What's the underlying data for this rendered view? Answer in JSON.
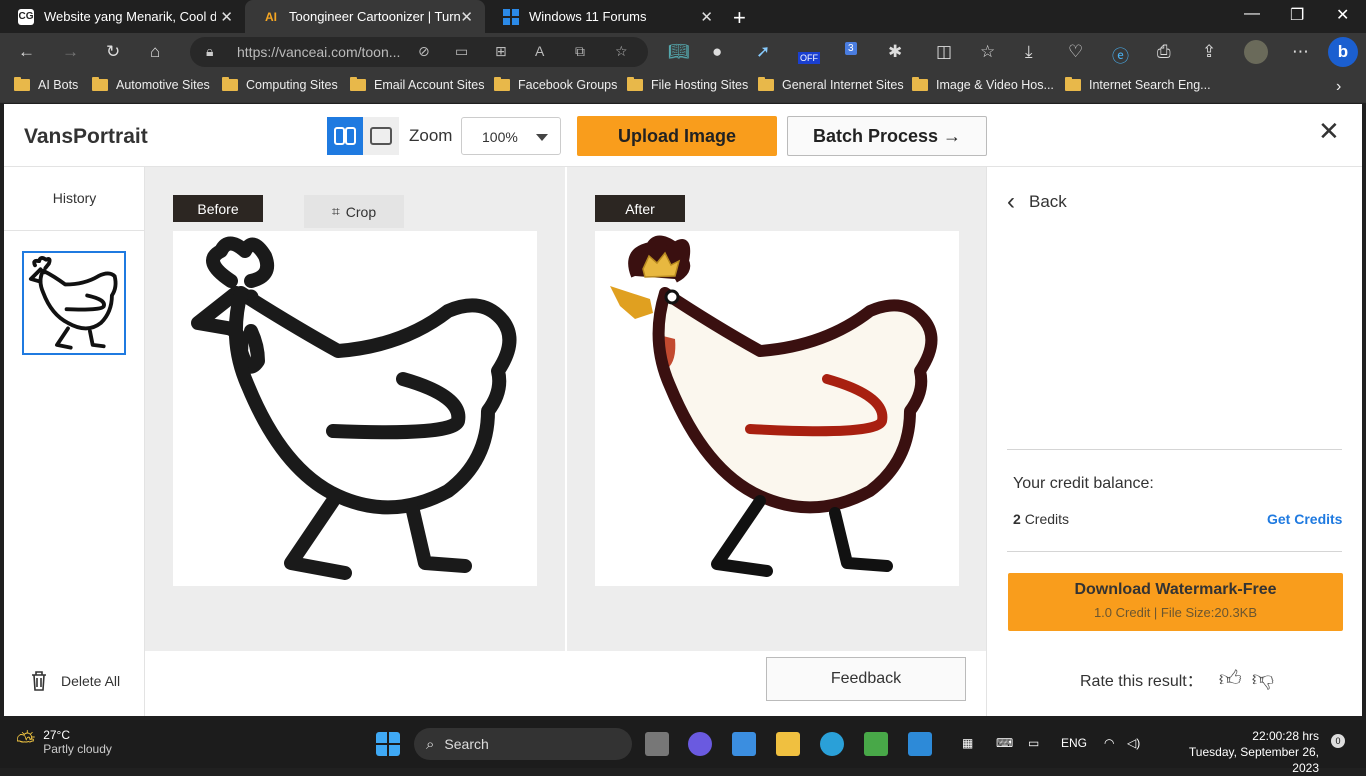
{
  "browser": {
    "tabs": [
      {
        "title": "Website yang Menarik, Cool dan",
        "favicon": "CG"
      },
      {
        "title": "Toongineer Cartoonizer | Turn Ph",
        "favicon": "AI"
      },
      {
        "title": "Windows 11 Forums",
        "favicon": "win"
      }
    ],
    "address": "https://vanceai.com/toon...",
    "bookmarks": [
      "AI Bots",
      "Automotive Sites",
      "Computing Sites",
      "Email Account Sites",
      "Facebook Groups",
      "File Hosting Sites",
      "General Internet Sites",
      "Image & Video Hos...",
      "Internet Search Eng..."
    ],
    "ext_badge_off": "OFF",
    "ext_badge_count": "3"
  },
  "app": {
    "brand": "VansPortrait",
    "zoom_label": "Zoom",
    "zoom_value": "100%",
    "upload_label": "Upload Image",
    "batch_label": "Batch Process →",
    "history_title": "History",
    "delete_all": "Delete All",
    "before_label": "Before",
    "crop_label": "Crop",
    "after_label": "After",
    "feedback_label": "Feedback",
    "back_label": "Back",
    "credit_balance_label": "Your credit balance:",
    "credits_count": "2",
    "credits_unit": "Credits",
    "get_credits": "Get Credits",
    "download_title": "Download Watermark-Free",
    "download_sub": "1.0 Credit | File Size:20.3KB",
    "rate_label": "Rate this result："
  },
  "taskbar": {
    "temp": "27°C",
    "weather": "Partly cloudy",
    "search": "Search",
    "lang": "ENG",
    "time": "22:00:28 hrs",
    "date": "Tuesday, September 26, 2023",
    "notif": "0"
  },
  "colors": {
    "accent": "#f99d1c",
    "link": "#1f7ae0",
    "tag": "#2c2622"
  }
}
